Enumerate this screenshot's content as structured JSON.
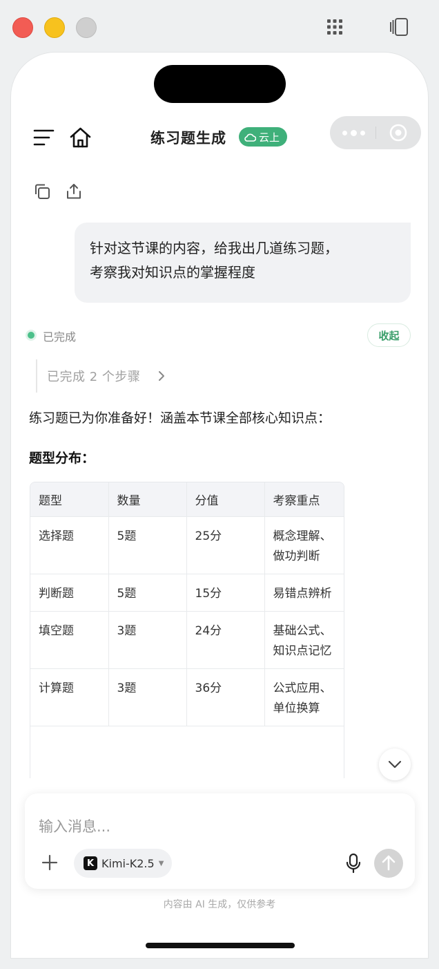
{
  "header": {
    "title": "练习题生成",
    "badge": "云上"
  },
  "user_message": {
    "line1": "针对这节课的内容，给我出几道练习题，",
    "line2": "考察我对知识点的掌握程度"
  },
  "status": {
    "text": "已完成",
    "collapse_label": "收起",
    "steps_label": "已完成 2 个步骤"
  },
  "answer": {
    "intro": "练习题已为你准备好！涵盖本节课全部核心知识点：",
    "subheading": "题型分布："
  },
  "table": {
    "headers": [
      "题型",
      "数量",
      "分值",
      "考察重点"
    ],
    "rows": [
      [
        "选择题",
        "5题",
        "25分",
        "概念理解、做功判断"
      ],
      [
        "判断题",
        "5题",
        "15分",
        "易错点辨析"
      ],
      [
        "填空题",
        "3题",
        "24分",
        "基础公式、知识点记忆"
      ],
      [
        "计算题",
        "3题",
        "36分",
        "公式应用、单位换算"
      ]
    ]
  },
  "composer": {
    "placeholder": "输入消息...",
    "model": "Kimi-K2.5",
    "model_logo": "K"
  },
  "footer": {
    "disclaimer": "内容由 AI 生成，仅供参考"
  },
  "colors": {
    "accent_green": "#3fb07a",
    "close_red": "#f25c54",
    "minimize_yellow": "#f7c21e"
  },
  "icons": [
    "menu-icon",
    "home-icon",
    "cloud-icon",
    "more-dots-icon",
    "target-icon",
    "copy-icon",
    "share-icon",
    "chevron-right-icon",
    "chevron-down-icon",
    "plus-icon",
    "microphone-icon",
    "send-arrow-icon",
    "grid-icon",
    "sidebar-toggle-icon"
  ]
}
